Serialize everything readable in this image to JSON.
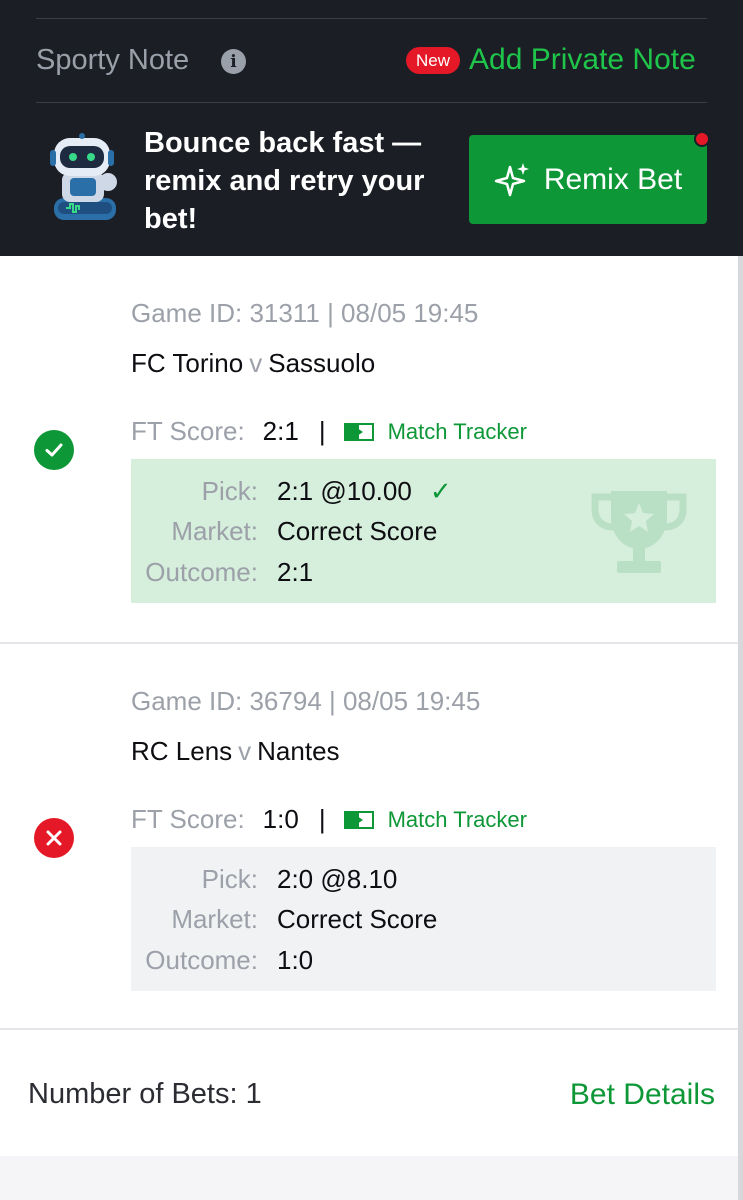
{
  "header": {
    "note_title": "Sporty Note",
    "new_badge": "New",
    "add_note": "Add Private Note",
    "promo_text": "Bounce back fast — remix and retry your bet!",
    "remix_label": "Remix Bet"
  },
  "games": [
    {
      "game_id_text": "Game ID: 31311 | 08/05 19:45",
      "home": "FC Torino",
      "versus": "v",
      "away": "Sassuolo",
      "ft_label": "FT Score:",
      "ft_score": "2:1",
      "separator": "|",
      "tracker_label": "Match Tracker",
      "status": "won",
      "pick_label": "Pick:",
      "pick_value": "2:1 @10.00",
      "market_label": "Market:",
      "market_value": "Correct Score",
      "outcome_label": "Outcome:",
      "outcome_value": "2:1"
    },
    {
      "game_id_text": "Game ID: 36794 | 08/05 19:45",
      "home": "RC Lens",
      "versus": "v",
      "away": "Nantes",
      "ft_label": "FT Score:",
      "ft_score": "1:0",
      "separator": "|",
      "tracker_label": "Match Tracker",
      "status": "lost",
      "pick_label": "Pick:",
      "pick_value": "2:0 @8.10",
      "market_label": "Market:",
      "market_value": "Correct Score",
      "outcome_label": "Outcome:",
      "outcome_value": "1:0"
    }
  ],
  "footer": {
    "number_of_bets": "Number of Bets: 1",
    "bet_details": "Bet Details"
  },
  "colors": {
    "header_bg": "#1b1e25",
    "accent_green": "#0d9737",
    "link_green": "#1fc54a",
    "error_red": "#e41827",
    "win_bg": "#d6eedc"
  },
  "icons": [
    "info-icon",
    "robot-icon",
    "sparkle-icon",
    "check-circle-icon",
    "cross-circle-icon",
    "match-tracker-icon",
    "checkmark-icon",
    "trophy-icon"
  ]
}
